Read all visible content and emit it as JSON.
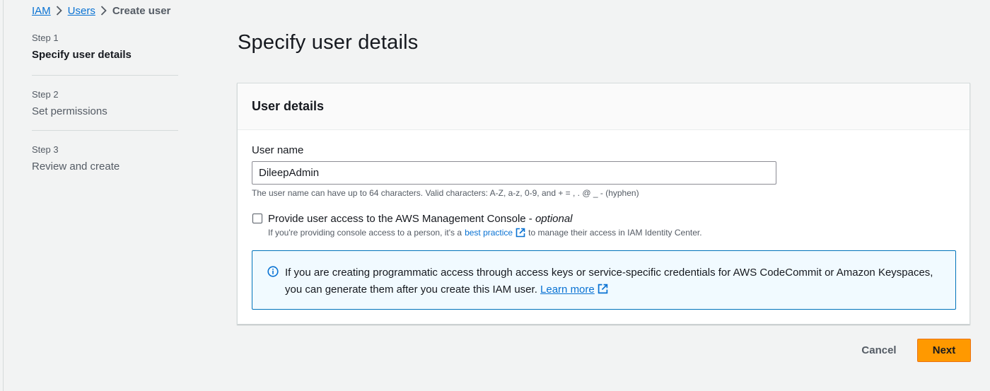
{
  "breadcrumb": {
    "items": [
      {
        "label": "IAM"
      },
      {
        "label": "Users"
      },
      {
        "label": "Create user"
      }
    ]
  },
  "steps": [
    {
      "number": "Step 1",
      "title": "Specify user details",
      "active": true
    },
    {
      "number": "Step 2",
      "title": "Set permissions",
      "active": false
    },
    {
      "number": "Step 3",
      "title": "Review and create",
      "active": false
    }
  ],
  "page": {
    "title": "Specify user details"
  },
  "user_details": {
    "header": "User details",
    "user_name": {
      "label": "User name",
      "value": "DileepAdmin",
      "constraint": "The user name can have up to 64 characters. Valid characters: A-Z, a-z, 0-9, and + = , . @ _ - (hyphen)"
    },
    "console_access": {
      "checked": false,
      "label": "Provide user access to the AWS Management Console - ",
      "optional": "optional",
      "description_before": "If you're providing console access to a person, it's a",
      "link": "best practice",
      "description_after": "to manage their access in IAM Identity Center."
    },
    "info_alert": {
      "text": "If you are creating programmatic access through access keys or service-specific credentials for AWS CodeCommit or Amazon Keyspaces, you can generate them after you create this IAM user.",
      "link": "Learn more"
    }
  },
  "actions": {
    "cancel": "Cancel",
    "next": "Next"
  },
  "colors": {
    "accent": "#0972d3",
    "primary_button": "#ff9900",
    "alert_bg": "#f1faff",
    "alert_border": "#0073bb"
  }
}
